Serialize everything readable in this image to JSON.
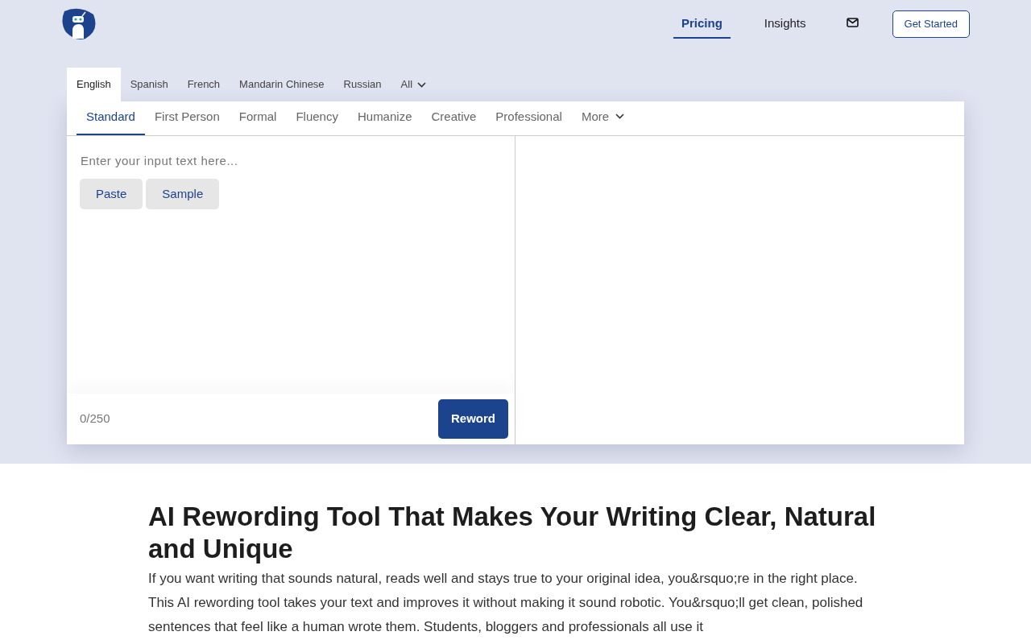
{
  "nav": {
    "links": [
      {
        "label": "Pricing",
        "selected": true
      },
      {
        "label": "Insights",
        "selected": false
      }
    ],
    "cta": "Get Started"
  },
  "languages": [
    {
      "label": "English",
      "selected": true
    },
    {
      "label": "Spanish",
      "selected": false
    },
    {
      "label": "French",
      "selected": false
    },
    {
      "label": "Mandarin Chinese",
      "selected": false
    },
    {
      "label": "Russian",
      "selected": false
    },
    {
      "label": "All",
      "selected": false,
      "kind": "dropdown"
    }
  ],
  "modes": [
    {
      "label": "Standard",
      "selected": true
    },
    {
      "label": "First Person",
      "selected": false
    },
    {
      "label": "Formal",
      "selected": false
    },
    {
      "label": "Fluency",
      "selected": false
    },
    {
      "label": "Humanize",
      "selected": false
    },
    {
      "label": "Creative",
      "selected": false
    },
    {
      "label": "Professional",
      "selected": false
    },
    {
      "label": "More",
      "selected": false,
      "kind": "dropdown"
    }
  ],
  "input": {
    "placeholder": "Enter your input text here...",
    "buttons": [
      "Paste",
      "Sample"
    ],
    "counter": "0/250",
    "submit": "Reword"
  },
  "article": {
    "heading": "AI Rewording Tool That Makes Your Writing Clear, Natural and Unique",
    "paragraph": "If you want writing that sounds natural, reads well and stays true to your original idea, you&rsquo;re in the right place. This AI rewording tool takes your text and improves it without making it sound robotic. You&rsquo;ll get clean, polished sentences that feel like a human wrote them. Students, bloggers and professionals all use it"
  }
}
